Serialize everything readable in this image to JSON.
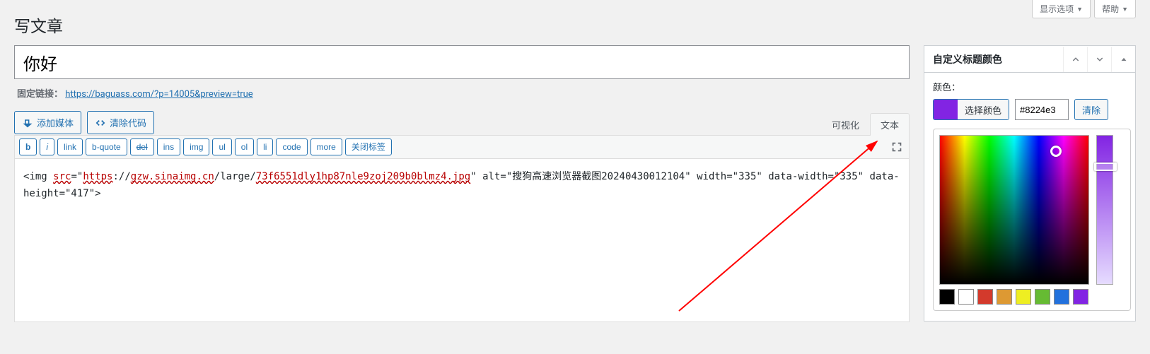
{
  "top": {
    "screen_options": "显示选项",
    "help": "帮助"
  },
  "page_title": "写文章",
  "title_value": "你好",
  "permalink": {
    "label": "固定链接：",
    "url_text": "https://baguass.com/?p=14005&preview=true"
  },
  "actions": {
    "add_media": "添加媒体",
    "clear_code": "清除代码"
  },
  "editor_tabs": {
    "visual": "可视化",
    "text": "文本"
  },
  "quicktags": {
    "b": "b",
    "i": "i",
    "link": "link",
    "bquote": "b-quote",
    "del": "del",
    "ins": "ins",
    "img": "img",
    "ul": "ul",
    "ol": "ol",
    "li": "li",
    "code": "code",
    "more": "more",
    "close": "关闭标签"
  },
  "editor_content": {
    "seg1": "<img ",
    "seg2_red": "src",
    "seg3": "=\"",
    "seg4_red": "https",
    "seg5": "://",
    "seg6_red": "gzw.sinaimg.cn",
    "seg7": "/large/",
    "seg8_red": "73f6551dly1hp87nle9zoj209b0blmz4.jpg",
    "seg9": "\" alt=\"搜狗高速浏览器截图20240430012104\" width=\"335\" data-width=\"335\" data-height=\"417\">"
  },
  "sidebar": {
    "panel_title": "自定义标题颜色",
    "color_label": "颜色：",
    "choose_color": "选择颜色",
    "hex_value": "#8224e3",
    "clear": "清除",
    "presets": [
      "#000000",
      "#ffffff",
      "#d33a2c",
      "#dd9933",
      "#eeee22",
      "#66bb33",
      "#2271dd",
      "#8224e3"
    ]
  }
}
